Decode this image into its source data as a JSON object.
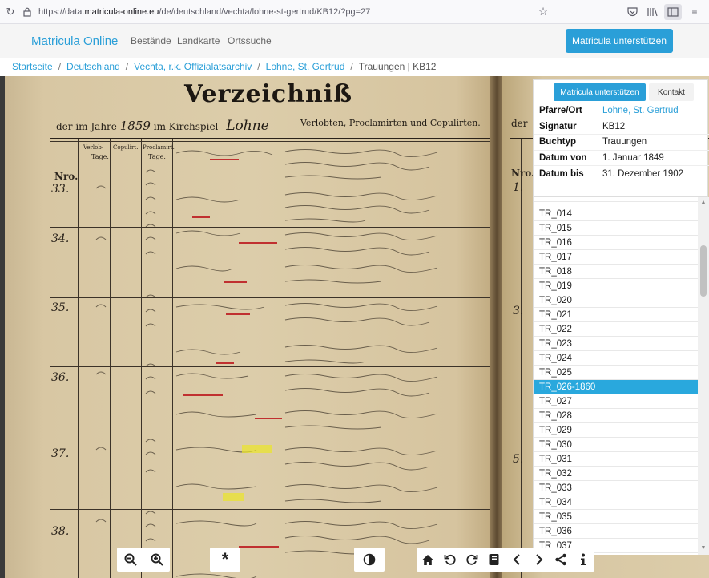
{
  "browser": {
    "url_prefix": "https://data.",
    "url_host": "matricula-online.eu",
    "url_path": "/de/deutschland/vechta/lohne-st-gertrud/KB12/?pg=27"
  },
  "nav": {
    "brand": "Matricula Online",
    "links": [
      "Bestände",
      "Landkarte",
      "Ortssuche"
    ],
    "support_button": "Matricula unterstützen"
  },
  "breadcrumb": {
    "items": [
      "Startseite",
      "Deutschland",
      "Vechta, r.k. Offizialatsarchiv",
      "Lohne, St. Gertrud"
    ],
    "current": "Trauungen | KB12"
  },
  "scan": {
    "title": "Verzeichniß",
    "subtitle_left": "der im Jahre",
    "year": "1859",
    "subtitle_mid": "im Kirchspiel",
    "parish": "Lohne",
    "subtitle_right": "Verlobten, Proclamirten und Copulirten.",
    "subtitle_next": "der",
    "col_verlob": "Verlob-",
    "col_copulirt": "Copulirt.",
    "col_proclam": "Proclamirt.",
    "col_tage": "Tage.",
    "col_nro": "Nro.",
    "entry_numbers": [
      "33.",
      "34.",
      "35.",
      "36.",
      "37.",
      "38."
    ],
    "right_page_numbers": [
      "1.",
      "3.",
      "5."
    ]
  },
  "info": {
    "support_button": "Matricula unterstützen",
    "contact_button": "Kontakt",
    "rows": [
      {
        "key": "Pfarre/Ort",
        "value": "Lohne, St. Gertrud"
      },
      {
        "key": "Signatur",
        "value": "KB12"
      },
      {
        "key": "Buchtyp",
        "value": "Trauungen"
      },
      {
        "key": "Datum von",
        "value": "1. Januar 1849"
      },
      {
        "key": "Datum bis",
        "value": "31. Dezember 1902"
      }
    ]
  },
  "image_list": {
    "items": [
      "TR_014",
      "TR_015",
      "TR_016",
      "TR_017",
      "TR_018",
      "TR_019",
      "TR_020",
      "TR_021",
      "TR_022",
      "TR_023",
      "TR_024",
      "TR_025",
      "TR_026-1860",
      "TR_027",
      "TR_028",
      "TR_029",
      "TR_030",
      "TR_031",
      "TR_032",
      "TR_033",
      "TR_034",
      "TR_035",
      "TR_036",
      "TR_037"
    ],
    "active": "TR_026-1860"
  },
  "toolbar": {
    "icons": [
      "zoom-out-icon",
      "zoom-in-icon",
      "asterisk-icon",
      "contrast-icon",
      "home-icon",
      "rotate-left-icon",
      "rotate-right-icon",
      "book-icon",
      "prev-icon",
      "next-icon",
      "share-icon",
      "info-icon"
    ]
  }
}
